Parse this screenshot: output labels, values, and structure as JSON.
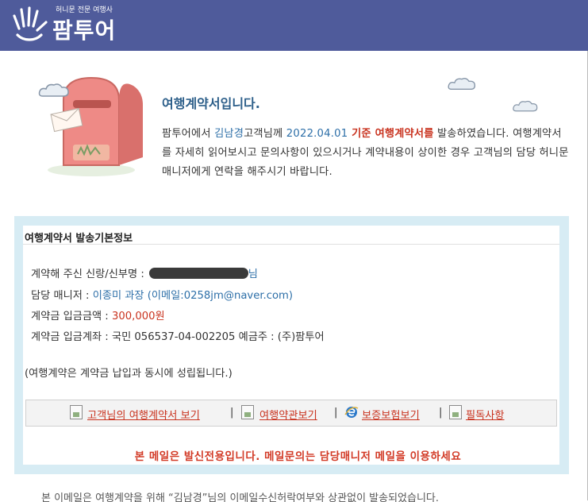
{
  "header": {
    "tagline": "허니문 전문 여행사",
    "brand": "팜투어",
    "bg_color": "#4f5b9b"
  },
  "intro": {
    "title": "여행계약서입니다.",
    "p1": "팜투어에서 ",
    "customer": "김남경",
    "p2": "고객님께 ",
    "date": "2022.04.01",
    "standard": " 기준 ",
    "doc": "여행계약서를",
    "p3": " 발송하였습니다. 여행계약서를 자세히 읽어보시고 문의사항이 있으시거나 계약내용이 상이한 경우 고객님의 담당 허니문 매니저에게 연락을 해주시기 바랍니다."
  },
  "info": {
    "heading": "여행계약서 발송기본정보",
    "contract_label": "계약해 주신 신랑/신부명 :",
    "contract_suffix": "님",
    "manager_label": "담당 매니저 : ",
    "manager_value": "이종미 과장 (이메일:0258jm@naver.com)",
    "deposit_label": "계약금 입금금액 : ",
    "deposit_value": "300,000원",
    "account_label": "계약금 입금계좌 : ",
    "account_value": "국민 056537-04-002205 예금주 : (주)팜투어",
    "note": "(여행계약은 계약금 납입과 동시에 성립됩니다.)"
  },
  "links": {
    "contract_view": "고객님의 여행계약서 보기",
    "terms_view": "여행약관보기",
    "insurance_view": "보증보험보기",
    "notice": "필독사항",
    "separator": "|",
    "icons": [
      "document-icon",
      "document-icon",
      "ie-icon",
      "document-icon"
    ]
  },
  "warning": "본 메일은 발신전용입니다. 메일문의는 담당매니저 메일을 이용하세요",
  "footer_cut": "본 이메일은 여행계약을 위해 “김남경”님의 이메일수신허락여부와 상관없이 발송되었습니다."
}
